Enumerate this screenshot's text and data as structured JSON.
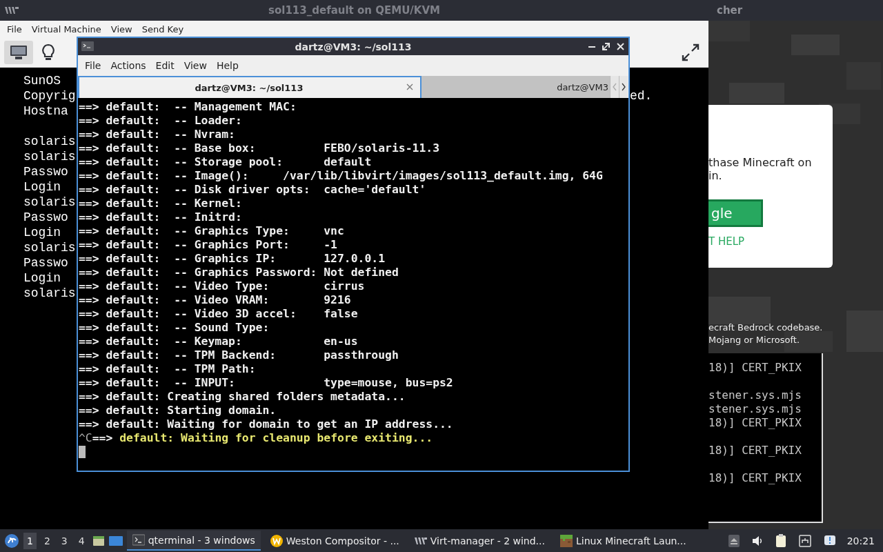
{
  "vm_window": {
    "title": "sol113_default on QEMU/KVM",
    "menu": [
      "File",
      "Virtual Machine",
      "View",
      "Send Key"
    ],
    "toolbar": [
      {
        "kind": "console",
        "selected": true
      },
      {
        "kind": "details",
        "selected": false
      }
    ],
    "console_blocks": [
      [
        "SunOS",
        "Copyrig",
        "Hostna"
      ],
      [
        "solaris",
        "solaris",
        "Passwo",
        "Login",
        "solaris",
        "Passwo",
        "Login",
        "solaris",
        "Passwo",
        "Login",
        "solaris"
      ]
    ],
    "console_fragment": "ed."
  },
  "terminal_window": {
    "title": "dartz@VM3: ~/sol113",
    "menu": [
      "File",
      "Actions",
      "Edit",
      "View",
      "Help"
    ],
    "tabs": [
      {
        "label": "dartz@VM3: ~/sol113",
        "selected": true
      },
      {
        "label": "dartz@VM3",
        "selected": false
      }
    ],
    "lines": [
      "==> default:  -- Management MAC:",
      "==> default:  -- Loader:",
      "==> default:  -- Nvram:",
      "==> default:  -- Base box:          FEBO/solaris-11.3",
      "==> default:  -- Storage pool:      default",
      "==> default:  -- Image():     /var/lib/libvirt/images/sol113_default.img, 64G",
      "==> default:  -- Disk driver opts:  cache='default'",
      "==> default:  -- Kernel:",
      "==> default:  -- Initrd:",
      "==> default:  -- Graphics Type:     vnc",
      "==> default:  -- Graphics Port:     -1",
      "==> default:  -- Graphics IP:       127.0.0.1",
      "==> default:  -- Graphics Password: Not defined",
      "==> default:  -- Video Type:        cirrus",
      "==> default:  -- Video VRAM:        9216",
      "==> default:  -- Video 3D accel:    false",
      "==> default:  -- Sound Type:",
      "==> default:  -- Keymap:            en-us",
      "==> default:  -- TPM Backend:       passthrough",
      "==> default:  -- TPM Path:",
      "==> default:  -- INPUT:             type=mouse, bus=ps2",
      "==> default: Creating shared folders metadata...",
      "==> default: Starting domain.",
      "==> default: Waiting for domain to get an IP address..."
    ],
    "last_line": {
      "control": "^C",
      "arrow": "==>",
      "message": "default: Waiting for cleanup before exiting..."
    }
  },
  "launcher_window": {
    "title": "cher",
    "message": [
      "thase Minecraft on",
      "in."
    ],
    "button": "gle",
    "link": "T HELP",
    "footer": [
      "ecraft Bedrock codebase.",
      "Mojang or Microsoft."
    ]
  },
  "log_window": {
    "blocks": [
      [
        "18)] CERT_PKIX"
      ],
      [
        "stener.sys.mjs",
        "stener.sys.mjs",
        "18)] CERT_PKIX"
      ],
      [
        "18)] CERT_PKIX"
      ],
      [
        "18)] CERT_PKIX"
      ]
    ]
  },
  "taskbar": {
    "workspaces": [
      {
        "label": "1",
        "selected": true
      },
      {
        "label": "2",
        "selected": false
      },
      {
        "label": "3",
        "selected": false
      },
      {
        "label": "4",
        "selected": false
      }
    ],
    "tasks": [
      {
        "kind": "terminal",
        "label": "qterminal - 3 windows",
        "selected": true
      },
      {
        "kind": "weston",
        "label": "Weston Compositor - ...",
        "selected": false
      },
      {
        "kind": "virt",
        "label": "Virt-manager - 2 wind...",
        "selected": false
      },
      {
        "kind": "minecraft",
        "label": "Linux Minecraft Laun...",
        "selected": false
      }
    ],
    "clock": "20:21"
  }
}
